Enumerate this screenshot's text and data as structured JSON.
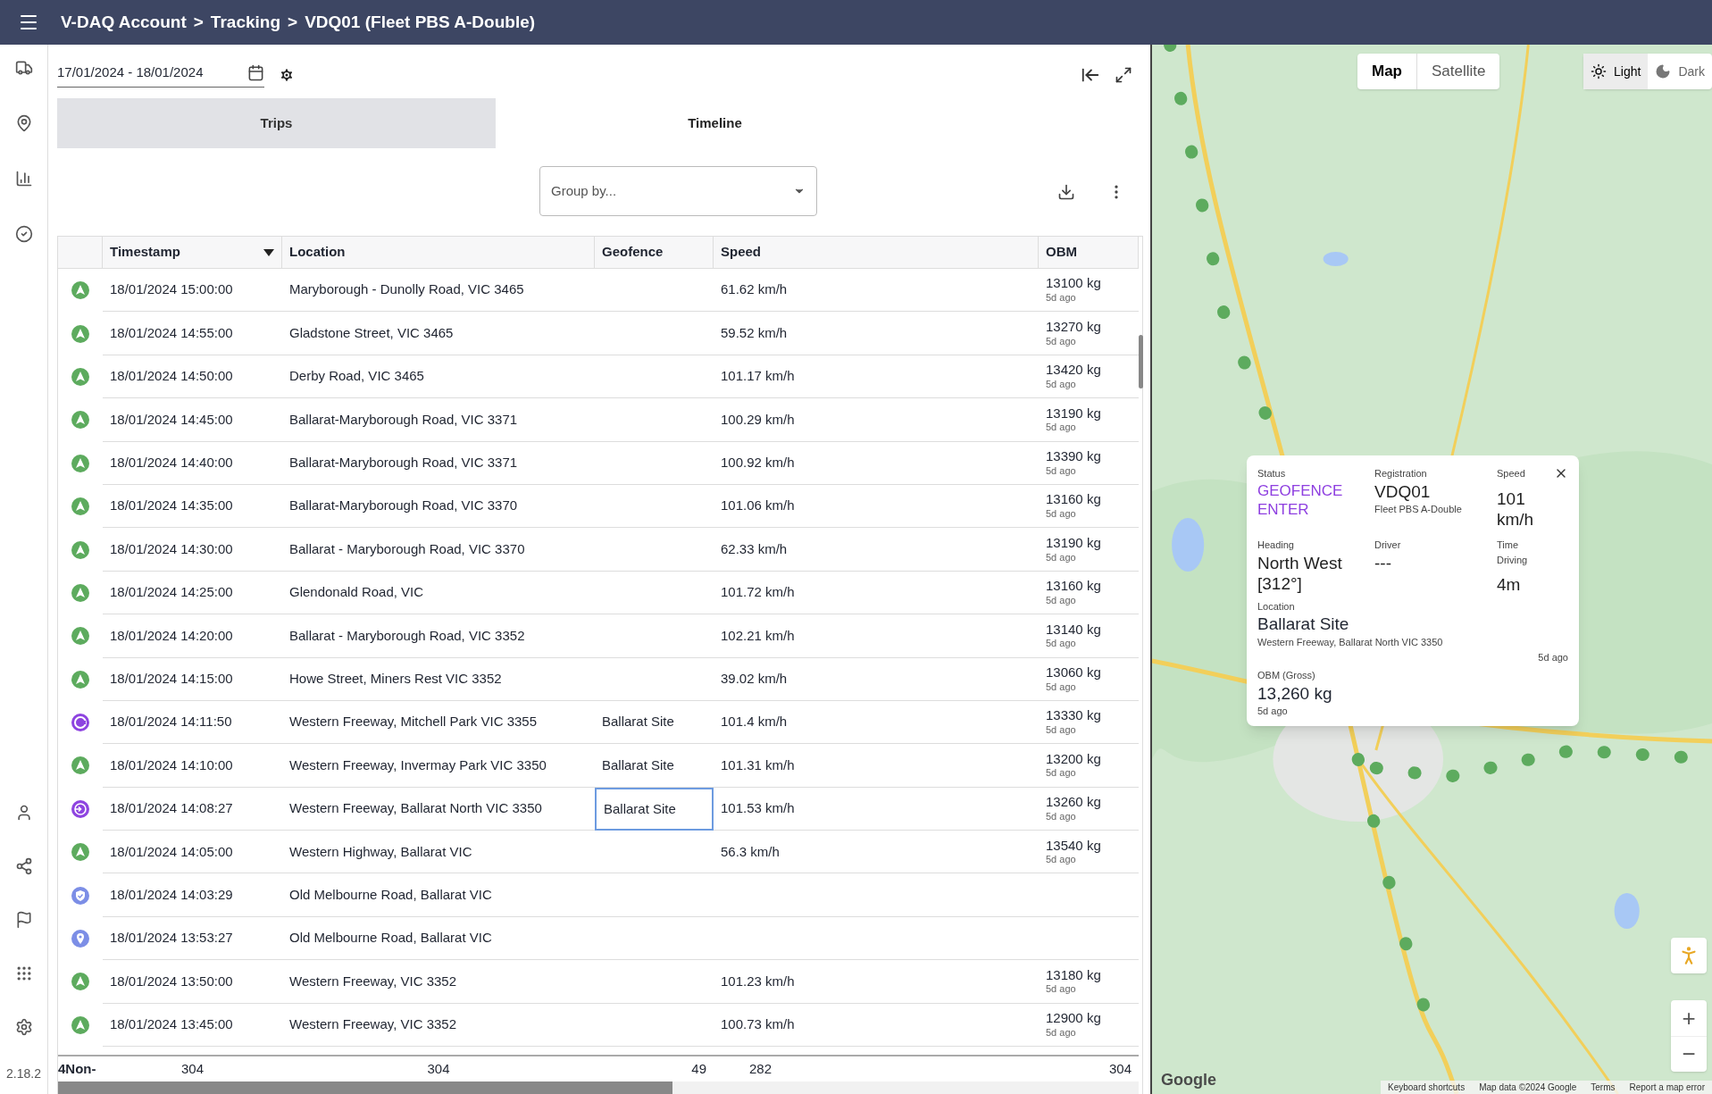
{
  "header": {
    "breadcrumbs": [
      {
        "label": "V-DAQ Account",
        "separator": ">"
      },
      {
        "label": "Tracking",
        "separator": ">"
      },
      {
        "label": "VDQ01 (Fleet PBS A-Double)"
      }
    ]
  },
  "sidebar": {
    "top_items": [
      {
        "kind": "truck"
      },
      {
        "kind": "pin"
      },
      {
        "kind": "chart"
      },
      {
        "kind": "check"
      }
    ],
    "bottom_items": [
      {
        "kind": "user"
      },
      {
        "kind": "share"
      },
      {
        "kind": "flag"
      },
      {
        "kind": "grid"
      },
      {
        "kind": "settings"
      }
    ],
    "version": "2.18.2"
  },
  "date_range": {
    "value": "17/01/2024 - 18/01/2024"
  },
  "tabs": [
    {
      "label": "Trips",
      "selected": false
    },
    {
      "label": "Timeline",
      "selected": true
    }
  ],
  "group_by": {
    "placeholder": "Group by..."
  },
  "table": {
    "columns": [
      {
        "label": "Timestamp",
        "sorted": true
      },
      {
        "label": "Location",
        "sorted": false
      },
      {
        "label": "Geofence",
        "sorted": false
      },
      {
        "label": "Speed",
        "sorted": false
      },
      {
        "label": "OBM",
        "sorted": false
      }
    ],
    "rows": [
      {
        "kind": "moving",
        "timestamp": "18/01/2024 15:00:00",
        "location": "Maryborough - Dunolly Road, VIC 3465",
        "speed": "61.62 km/h",
        "obm": "13100 kg",
        "obm_age": "5d ago",
        "selected": false
      },
      {
        "kind": "moving",
        "timestamp": "18/01/2024 14:55:00",
        "location": "Gladstone Street, VIC 3465",
        "speed": "59.52 km/h",
        "obm": "13270 kg",
        "obm_age": "5d ago",
        "selected": false
      },
      {
        "kind": "moving",
        "timestamp": "18/01/2024 14:50:00",
        "location": "Derby Road, VIC 3465",
        "speed": "101.17 km/h",
        "obm": "13420 kg",
        "obm_age": "5d ago",
        "selected": false
      },
      {
        "kind": "moving",
        "timestamp": "18/01/2024 14:45:00",
        "location": "Ballarat-Maryborough Road, VIC 3371",
        "speed": "100.29 km/h",
        "obm": "13190 kg",
        "obm_age": "5d ago",
        "selected": false
      },
      {
        "kind": "moving",
        "timestamp": "18/01/2024 14:40:00",
        "location": "Ballarat-Maryborough Road, VIC 3371",
        "speed": "100.92 km/h",
        "obm": "13390 kg",
        "obm_age": "5d ago",
        "selected": false
      },
      {
        "kind": "moving",
        "timestamp": "18/01/2024 14:35:00",
        "location": "Ballarat-Maryborough Road, VIC 3370",
        "speed": "101.06 km/h",
        "obm": "13160 kg",
        "obm_age": "5d ago",
        "selected": false
      },
      {
        "kind": "moving",
        "timestamp": "18/01/2024 14:30:00",
        "location": "Ballarat - Maryborough Road, VIC 3370",
        "speed": "62.33 km/h",
        "obm": "13190 kg",
        "obm_age": "5d ago",
        "selected": false
      },
      {
        "kind": "moving",
        "timestamp": "18/01/2024 14:25:00",
        "location": "Glendonald Road, VIC",
        "speed": "101.72 km/h",
        "obm": "13160 kg",
        "obm_age": "5d ago",
        "selected": false
      },
      {
        "kind": "moving",
        "timestamp": "18/01/2024 14:20:00",
        "location": "Ballarat - Maryborough Road, VIC 3352",
        "speed": "102.21 km/h",
        "obm": "13140 kg",
        "obm_age": "5d ago",
        "selected": false
      },
      {
        "kind": "moving",
        "timestamp": "18/01/2024 14:15:00",
        "location": "Howe Street, Miners Rest VIC 3352",
        "speed": "39.02 km/h",
        "obm": "13060 kg",
        "obm_age": "5d ago",
        "selected": false
      },
      {
        "kind": "geofence_exit",
        "timestamp": "18/01/2024 14:11:50",
        "location": "Western Freeway, Mitchell Park VIC 3355",
        "geofence": "Ballarat Site",
        "speed": "101.4 km/h",
        "obm": "13330 kg",
        "obm_age": "5d ago",
        "selected": false
      },
      {
        "kind": "moving",
        "timestamp": "18/01/2024 14:10:00",
        "location": "Western Freeway, Invermay Park VIC 3350",
        "geofence": "Ballarat Site",
        "speed": "101.31 km/h",
        "obm": "13200 kg",
        "obm_age": "5d ago",
        "selected": false
      },
      {
        "kind": "geofence_enter",
        "timestamp": "18/01/2024 14:08:27",
        "location": "Western Freeway, Ballarat North VIC 3350",
        "geofence": "Ballarat Site",
        "speed": "101.53 km/h",
        "obm": "13260 kg",
        "obm_age": "5d ago",
        "selected": true
      },
      {
        "kind": "moving",
        "timestamp": "18/01/2024 14:05:00",
        "location": "Western Highway, Ballarat VIC",
        "speed": "56.3 km/h",
        "obm": "13540 kg",
        "obm_age": "5d ago",
        "selected": false
      },
      {
        "kind": "stop",
        "timestamp": "18/01/2024 14:03:29",
        "location": "Old Melbourne Road, Ballarat VIC",
        "selected": false
      },
      {
        "kind": "parked",
        "timestamp": "18/01/2024 13:53:27",
        "location": "Old Melbourne Road, Ballarat VIC",
        "selected": false
      },
      {
        "kind": "moving",
        "timestamp": "18/01/2024 13:50:00",
        "location": "Western Freeway, VIC 3352",
        "speed": "101.23 km/h",
        "obm": "13180 kg",
        "obm_age": "5d ago",
        "selected": false
      },
      {
        "kind": "moving",
        "timestamp": "18/01/2024 13:45:00",
        "location": "Western Freeway, VIC 3352",
        "speed": "100.73 km/h",
        "obm": "12900 kg",
        "obm_age": "5d ago",
        "selected": false
      }
    ],
    "footer": {
      "label": "4Non-",
      "timestamp": "304",
      "location": "304",
      "geofence": "49",
      "speed": "282",
      "obm": "304"
    }
  },
  "map": {
    "type_toggle": [
      {
        "label": "Map",
        "selected": true
      },
      {
        "label": "Satellite",
        "selected": false
      }
    ],
    "theme_toggle": [
      {
        "label": "Light",
        "kind": "sun",
        "selected": true
      },
      {
        "label": "Dark",
        "kind": "moon",
        "selected": false
      }
    ],
    "popup": {
      "fields": [
        {
          "label": "Status",
          "value": "GEOFENCE ENTER",
          "kind": "status"
        },
        {
          "label": "Registration",
          "value": "VDQ01",
          "sub": "Fleet PBS A-Double"
        },
        {
          "label": "Speed",
          "value": "101 km/h"
        },
        {
          "label": "Heading",
          "value": "North West [312°]"
        },
        {
          "label": "Driver",
          "value": "---"
        },
        {
          "label": "Time Driving",
          "value": "4m"
        }
      ],
      "location_label": "Location",
      "location": "Ballarat Site",
      "address": "Western Freeway, Ballarat North VIC 3350",
      "location_age": "5d ago",
      "obm_label": "OBM (Gross)",
      "obm": "13,260 kg",
      "obm_age": "5d ago"
    },
    "logo": "Google",
    "attribution": [
      "Keyboard shortcuts",
      "Map data ©2024 Google",
      "Terms",
      "Report a map error"
    ],
    "zoom_in": "+",
    "zoom_out": "−"
  }
}
